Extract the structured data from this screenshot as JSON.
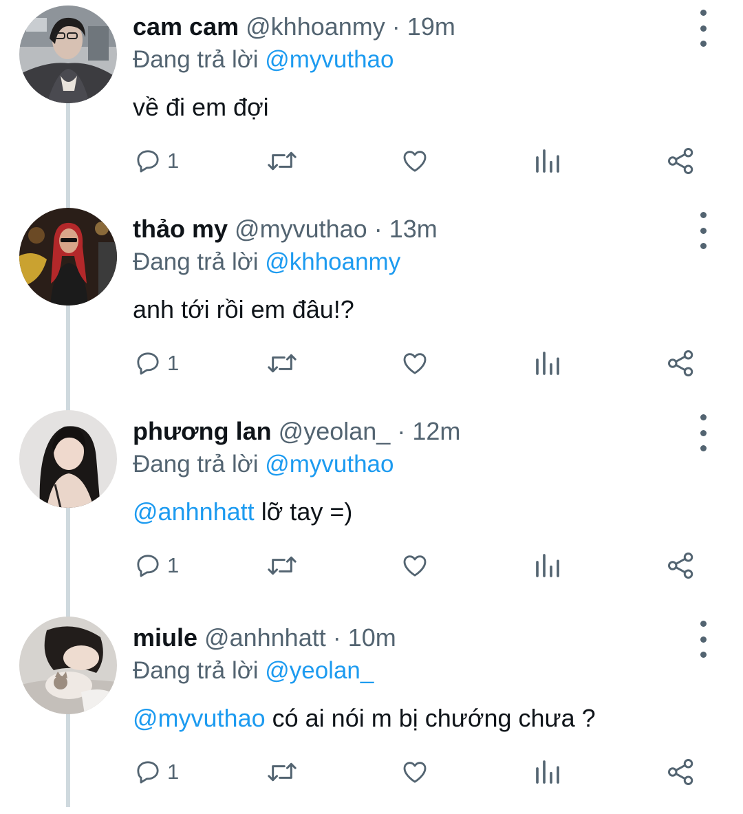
{
  "reply_prefix": "Đang trả lời",
  "tweets": [
    {
      "name": "cam cam",
      "handle": "@khhoanmy",
      "separator": "·",
      "time": "19m",
      "reply_to": "@myvuthao",
      "mention": "",
      "text": "về đi em đợi",
      "reply_count": "1",
      "avatar": "woman-selfie-photo"
    },
    {
      "name": "thảo my",
      "handle": "@myvuthao",
      "separator": "·",
      "time": "13m",
      "reply_to": "@khhoanmy",
      "mention": "",
      "text": "anh tới rồi em đâu!?",
      "reply_count": "1",
      "avatar": "red-hair-concert-photo"
    },
    {
      "name": "phương lan",
      "handle": "@yeolan_",
      "separator": "·",
      "time": "12m",
      "reply_to": "@myvuthao",
      "mention": "@anhnhatt",
      "text": "lỡ tay =)",
      "reply_count": "1",
      "avatar": "girl-long-hair-photo"
    },
    {
      "name": "miule",
      "handle": "@anhnhatt",
      "separator": "·",
      "time": "10m",
      "reply_to": "@yeolan_",
      "mention": "@myvuthao",
      "text": "có ai nói m bị chướng chưa ?",
      "reply_count": "1",
      "avatar": "girl-sleeping-with-cat-photo"
    }
  ],
  "icons": {
    "reply": "reply-icon",
    "retweet": "retweet-icon",
    "like": "heart-icon",
    "views": "analytics-icon",
    "share": "share-icon",
    "more": "more-vertical-icon"
  },
  "colors": {
    "text": "#0f1419",
    "secondary": "#536471",
    "accent": "#1d9bf0",
    "thread_line": "#cfd9de"
  }
}
